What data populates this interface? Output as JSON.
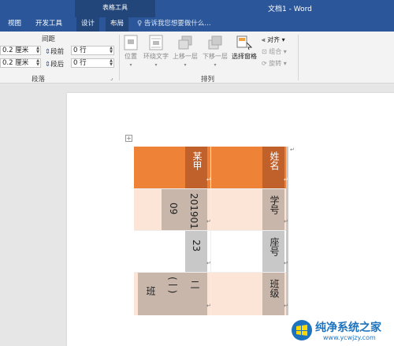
{
  "window": {
    "context_group": "表格工具",
    "doc_title": "文档1 - Word",
    "colors": {
      "titlebar": "#2b579a",
      "context_tab": "#224679",
      "header_row": "#ee8236",
      "gray_cell": "#c8b6aa",
      "pink_cell": "#fce4d6"
    }
  },
  "tabs": [
    "视图",
    "开发工具",
    "设计",
    "布局"
  ],
  "tell_me": "♀ 告诉我您想要做什么...",
  "ribbon": {
    "paragraph": {
      "spacing_title": "间距",
      "left_indent": "0.2 厘米",
      "right_indent": "0.2 厘米",
      "before_label": "段前",
      "before_value": "0 行",
      "after_label": "段后",
      "after_value": "0 行",
      "group_name": "段落"
    },
    "arrange": {
      "position": "位置",
      "wrap_text": "环绕文字",
      "bring_forward": "上移一层",
      "send_backward": "下移一层",
      "selection_pane": "选择窗格",
      "align": "对齐",
      "group": "组合",
      "rotate": "旋转",
      "group_name": "排列"
    }
  },
  "table": {
    "header": {
      "label": "姓名",
      "value": "某甲"
    },
    "rows": [
      {
        "label": "学号",
        "values": [
          "201901",
          "09"
        ]
      },
      {
        "label": "座号",
        "values": [
          "23"
        ]
      },
      {
        "label": "班级",
        "values": [
          "二",
          "(一)",
          "班"
        ]
      }
    ]
  },
  "watermark": {
    "name": "纯净系统之家",
    "url": "www.ycwjzy.com"
  }
}
